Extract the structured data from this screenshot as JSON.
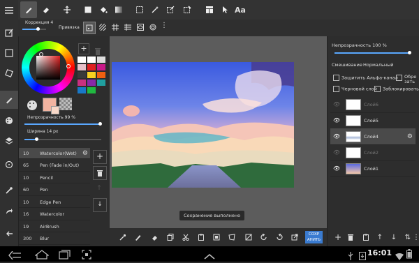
{
  "top_toolbar": {
    "text_tool_label": "Aa"
  },
  "sub_toolbar": {
    "correction_label": "Коррекция 4",
    "snap_label": "Привязка"
  },
  "color_panel": {
    "plus_label": "+",
    "swatches": [
      "#ffffff",
      "#ffffff",
      "#dcdcdc",
      "#e8c0c8",
      "#e02020",
      "#c81888",
      "#3a3a3a",
      "#f8d020",
      "#f06010",
      "#c83080",
      "#8828a8",
      "#20a0a0",
      "#1878c8",
      "#20b840"
    ]
  },
  "brush_panel": {
    "opacity_label": "Непрозрачность 99 %",
    "width_label": "Ширина 14 px",
    "brushes": [
      {
        "num": "10",
        "name": "Watercolor(Wet)",
        "selected": true
      },
      {
        "num": "65",
        "name": "Pen (Fade in/Out)"
      },
      {
        "num": "10",
        "name": "Pencil"
      },
      {
        "num": "60",
        "name": "Pen"
      },
      {
        "num": "10",
        "name": "Edge Pen"
      },
      {
        "num": "16",
        "name": "Watercolor"
      },
      {
        "num": "19",
        "name": "AirBrush"
      },
      {
        "num": "300",
        "name": "Blur"
      }
    ]
  },
  "canvas": {
    "toast": "Сохранение выполнено"
  },
  "bottom_toolbar": {
    "save_label_1": "СОХР",
    "save_label_2": "АНИТЬ"
  },
  "layer_panel": {
    "opacity_label": "Непрозрачность 100 %",
    "blend_label": "Смешивание",
    "blend_value": "Нормальный",
    "protect_alpha": "Защитить Альфа-канал",
    "clipping": "Обре зать",
    "draft": "Черновой слой",
    "lock": "Заблокировать",
    "layers": [
      {
        "name": "Слой6",
        "visible": false
      },
      {
        "name": "Слой5",
        "visible": true
      },
      {
        "name": "Слой4",
        "visible": true,
        "selected": true
      },
      {
        "name": "Слой2",
        "visible": false
      },
      {
        "name": "Слой1",
        "visible": true
      }
    ]
  },
  "status": {
    "time": "16:01"
  }
}
